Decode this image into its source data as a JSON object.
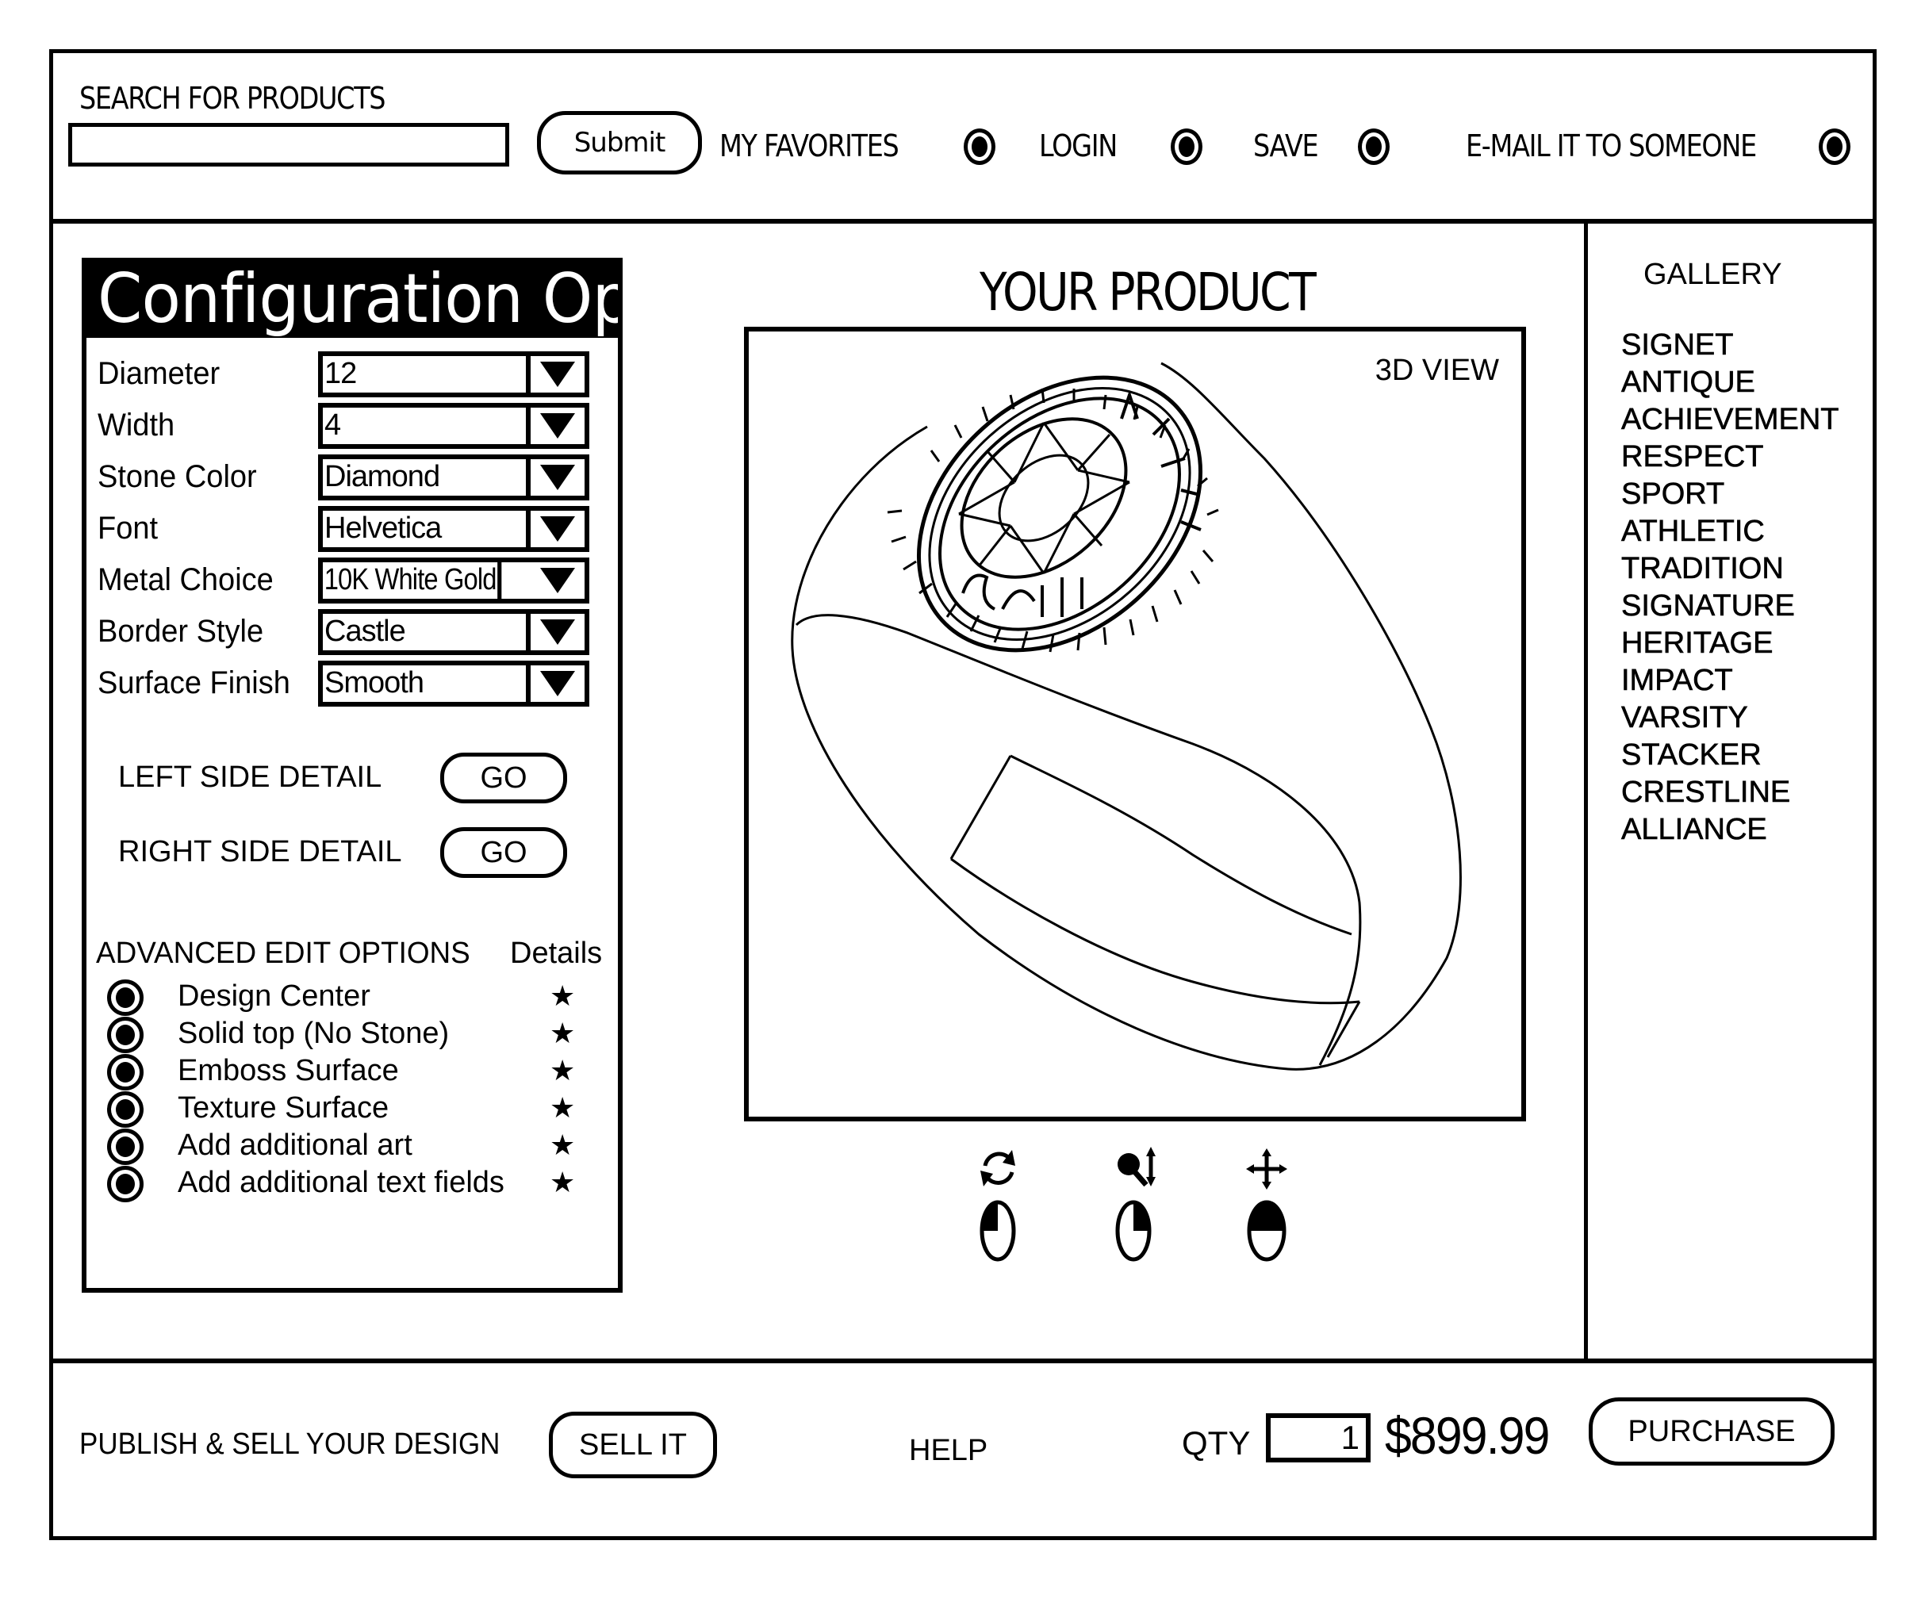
{
  "header": {
    "search_label": "SEARCH FOR PRODUCTS",
    "search_value": "",
    "submit_label": "Submit",
    "links": [
      {
        "label": "MY FAVORITES",
        "icon": "radio-selected-icon"
      },
      {
        "label": "LOGIN",
        "icon": "radio-selected-icon"
      },
      {
        "label": "SAVE",
        "icon": "radio-selected-icon"
      },
      {
        "label": "E-MAIL IT TO SOMEONE",
        "icon": "radio-selected-icon"
      }
    ]
  },
  "config": {
    "title": "Configuration Options",
    "fields": [
      {
        "label": "Diameter",
        "value": "12"
      },
      {
        "label": "Width",
        "value": "4"
      },
      {
        "label": "Stone Color",
        "value": "Diamond"
      },
      {
        "label": "Font",
        "value": "Helvetica"
      },
      {
        "label": "Metal Choice",
        "value": "10K White Gold"
      },
      {
        "label": "Border Style",
        "value": "Castle"
      },
      {
        "label": "Surface Finish",
        "value": "Smooth"
      }
    ],
    "side_details": [
      {
        "label": "LEFT SIDE DETAIL",
        "button": "GO"
      },
      {
        "label": "RIGHT SIDE DETAIL",
        "button": "GO"
      }
    ],
    "advanced": {
      "header": "ADVANCED EDIT OPTIONS",
      "details_header": "Details",
      "details_icon": "star-icon",
      "options": [
        "Design Center",
        "Solid top (No Stone)",
        "Emboss Surface",
        "Texture Surface",
        "Add additional art",
        "Add additional text fields"
      ]
    }
  },
  "product": {
    "title": "YOUR PRODUCT",
    "view_mode": "3D VIEW",
    "controls": [
      {
        "name": "rotate",
        "icon": "rotate-icon",
        "mouse": "left-button"
      },
      {
        "name": "zoom",
        "icon": "zoom-icon",
        "mouse": "right-button"
      },
      {
        "name": "pan",
        "icon": "pan-icon",
        "mouse": "middle-button"
      }
    ]
  },
  "gallery": {
    "title": "GALLERY",
    "items": [
      "SIGNET",
      "ANTIQUE",
      "ACHIEVEMENT",
      "RESPECT",
      "SPORT",
      "ATHLETIC",
      "TRADITION",
      "SIGNATURE",
      "HERITAGE",
      "IMPACT",
      "VARSITY",
      "STACKER",
      "CRESTLINE",
      "ALLIANCE"
    ]
  },
  "footer": {
    "publish_label": "PUBLISH & SELL YOUR DESIGN",
    "sell_button": "SELL IT",
    "help_label": "HELP",
    "qty_label": "QTY",
    "qty_value": "1",
    "price": "$899.99",
    "purchase_button": "PURCHASE"
  }
}
